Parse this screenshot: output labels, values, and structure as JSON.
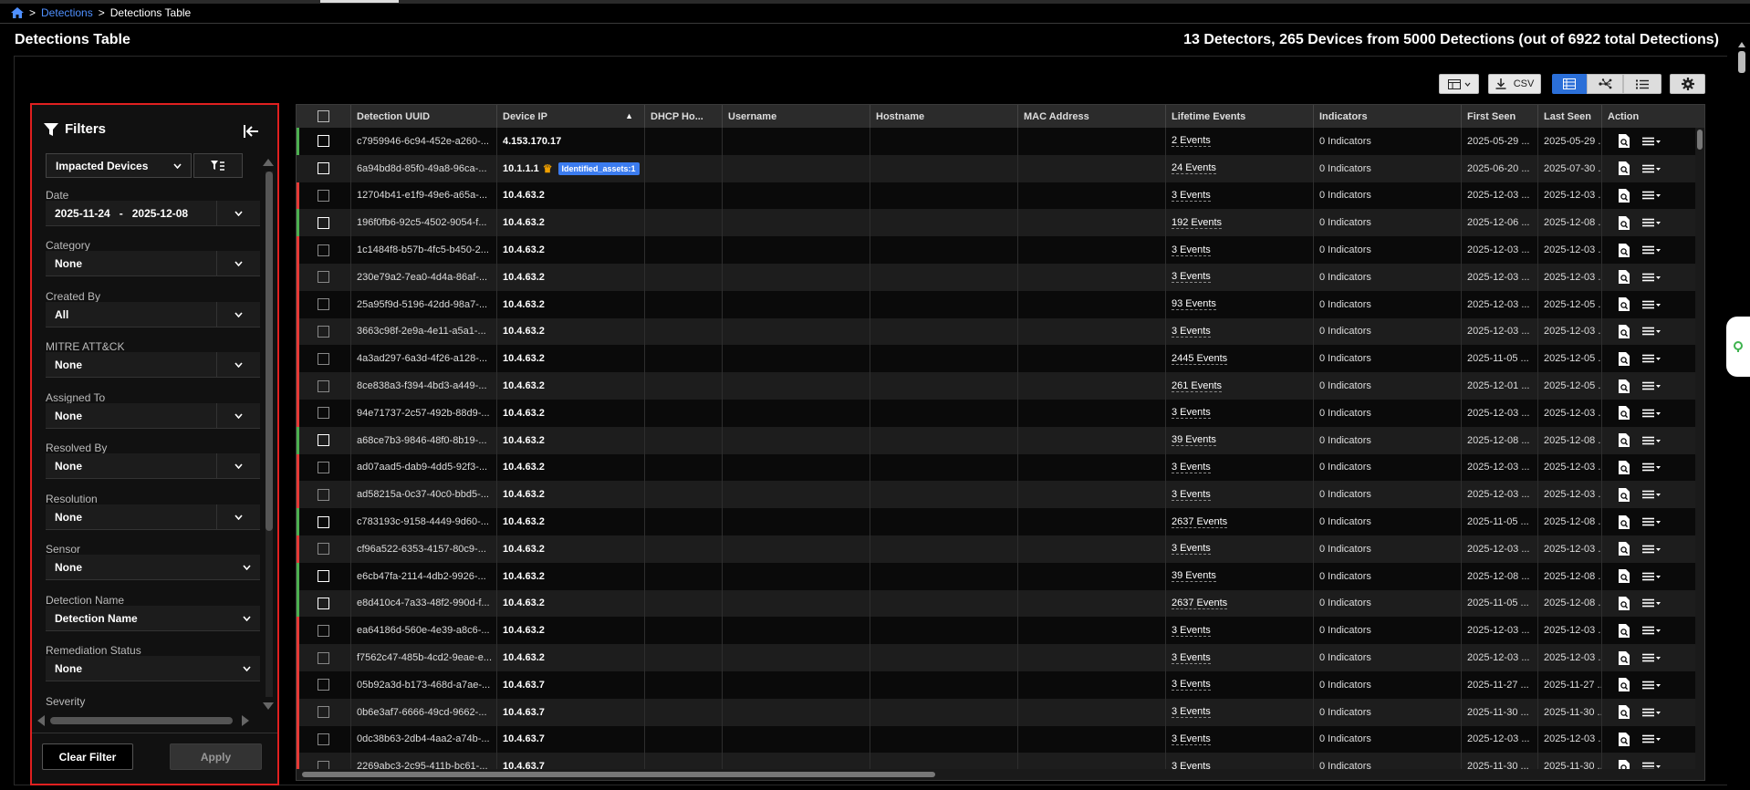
{
  "breadcrumb": {
    "root": "Detections",
    "sep": ">",
    "current": "Detections Table"
  },
  "header": {
    "title": "Detections Table",
    "summary": "13 Detectors, 265 Devices from 5000 Detections (out of 6922 total Detections)"
  },
  "toolbar": {
    "csv_label": "CSV"
  },
  "filters": {
    "title": "Filters",
    "view_select": "Impacted Devices",
    "fields": [
      {
        "label": "Date",
        "value": "2025-11-24   -   2025-12-08"
      },
      {
        "label": "Category",
        "value": "None"
      },
      {
        "label": "Created By",
        "value": "All"
      },
      {
        "label": "MITRE ATT&CK",
        "value": "None"
      },
      {
        "label": "Assigned To",
        "value": "None"
      },
      {
        "label": "Resolved By",
        "value": "None"
      },
      {
        "label": "Resolution",
        "value": "None"
      },
      {
        "label": "Sensor",
        "value": "None"
      },
      {
        "label": "Detection Name",
        "value": "Detection Name"
      },
      {
        "label": "Remediation Status",
        "value": "None"
      },
      {
        "label": "Severity",
        "value": ""
      }
    ],
    "clear_label": "Clear Filter",
    "apply_label": "Apply"
  },
  "table": {
    "columns": [
      "Detection UUID",
      "Device IP",
      "DHCP Ho...",
      "Username",
      "Hostname",
      "MAC Address",
      "Lifetime Events",
      "Indicators",
      "First Seen",
      "Last Seen",
      "Action"
    ],
    "sort_indicator": "▲",
    "tag_text": "Identified_assets:1",
    "crown_glyph": "♛",
    "rows": [
      {
        "uuid": "c7959946-6c94-452e-a260-...",
        "ip": "4.153.170.17",
        "events": "2 Events",
        "indicators": "0 Indicators",
        "first": "2025-05-29 ...",
        "last": "2025-05-29 ...",
        "flag": "#4caf50"
      },
      {
        "uuid": "6a94bd8d-85f0-49a8-96ca-...",
        "ip": "10.1.1.1",
        "crown": true,
        "tag": true,
        "events": "24 Events",
        "indicators": "0 Indicators",
        "first": "2025-06-20 ...",
        "last": "2025-07-30 ...",
        "flag": ""
      },
      {
        "uuid": "12704b41-e1f9-49e6-a65a-...",
        "ip": "10.4.63.2",
        "events": "3 Events",
        "indicators": "0 Indicators",
        "first": "2025-12-03 ...",
        "last": "2025-12-03 ...",
        "flag": "#e53935"
      },
      {
        "uuid": "196f0fb6-92c5-4502-9054-f...",
        "ip": "10.4.63.2",
        "events": "192 Events",
        "indicators": "0 Indicators",
        "first": "2025-12-06 ...",
        "last": "2025-12-08 ...",
        "flag": "#4caf50"
      },
      {
        "uuid": "1c1484f8-b57b-4fc5-b450-2...",
        "ip": "10.4.63.2",
        "events": "3 Events",
        "indicators": "0 Indicators",
        "first": "2025-12-03 ...",
        "last": "2025-12-03 ...",
        "flag": "#e53935"
      },
      {
        "uuid": "230e79a2-7ea0-4d4a-86af-...",
        "ip": "10.4.63.2",
        "events": "3 Events",
        "indicators": "0 Indicators",
        "first": "2025-12-03 ...",
        "last": "2025-12-03 ...",
        "flag": "#e53935"
      },
      {
        "uuid": "25a95f9d-5196-42dd-98a7-...",
        "ip": "10.4.63.2",
        "events": "93 Events",
        "indicators": "0 Indicators",
        "first": "2025-12-03 ...",
        "last": "2025-12-05 ...",
        "flag": "#e53935"
      },
      {
        "uuid": "3663c98f-2e9a-4e11-a5a1-...",
        "ip": "10.4.63.2",
        "events": "3 Events",
        "indicators": "0 Indicators",
        "first": "2025-12-03 ...",
        "last": "2025-12-03 ...",
        "flag": "#e53935"
      },
      {
        "uuid": "4a3ad297-6a3d-4f26-a128-...",
        "ip": "10.4.63.2",
        "events": "2445 Events",
        "indicators": "0 Indicators",
        "first": "2025-11-05 ...",
        "last": "2025-12-05 ...",
        "flag": "#e53935"
      },
      {
        "uuid": "8ce838a3-f394-4bd3-a449-...",
        "ip": "10.4.63.2",
        "events": "261 Events",
        "indicators": "0 Indicators",
        "first": "2025-12-01 ...",
        "last": "2025-12-05 ...",
        "flag": "#e53935"
      },
      {
        "uuid": "94e71737-2c57-492b-88d9-...",
        "ip": "10.4.63.2",
        "events": "3 Events",
        "indicators": "0 Indicators",
        "first": "2025-12-03 ...",
        "last": "2025-12-03 ...",
        "flag": "#e53935"
      },
      {
        "uuid": "a68ce7b3-9846-48f0-8b19-...",
        "ip": "10.4.63.2",
        "events": "39 Events",
        "indicators": "0 Indicators",
        "first": "2025-12-08 ...",
        "last": "2025-12-08 ...",
        "flag": "#4caf50"
      },
      {
        "uuid": "ad07aad5-dab9-4dd5-92f3-...",
        "ip": "10.4.63.2",
        "events": "3 Events",
        "indicators": "0 Indicators",
        "first": "2025-12-03 ...",
        "last": "2025-12-03 ...",
        "flag": "#e53935"
      },
      {
        "uuid": "ad58215a-0c37-40c0-bbd5-...",
        "ip": "10.4.63.2",
        "events": "3 Events",
        "indicators": "0 Indicators",
        "first": "2025-12-03 ...",
        "last": "2025-12-03 ...",
        "flag": "#e53935"
      },
      {
        "uuid": "c783193c-9158-4449-9d60-...",
        "ip": "10.4.63.2",
        "events": "2637 Events",
        "indicators": "0 Indicators",
        "first": "2025-11-05 ...",
        "last": "2025-12-08 ...",
        "flag": "#4caf50"
      },
      {
        "uuid": "cf96a522-6353-4157-80c9-...",
        "ip": "10.4.63.2",
        "events": "3 Events",
        "indicators": "0 Indicators",
        "first": "2025-12-03 ...",
        "last": "2025-12-03 ...",
        "flag": "#e53935"
      },
      {
        "uuid": "e6cb47fa-2114-4db2-9926-...",
        "ip": "10.4.63.2",
        "events": "39 Events",
        "indicators": "0 Indicators",
        "first": "2025-12-08 ...",
        "last": "2025-12-08 ...",
        "flag": "#4caf50"
      },
      {
        "uuid": "e8d410c4-7a33-48f2-990d-f...",
        "ip": "10.4.63.2",
        "events": "2637 Events",
        "indicators": "0 Indicators",
        "first": "2025-11-05 ...",
        "last": "2025-12-08 ...",
        "flag": "#4caf50"
      },
      {
        "uuid": "ea64186d-560e-4e39-a8c6-...",
        "ip": "10.4.63.2",
        "events": "3 Events",
        "indicators": "0 Indicators",
        "first": "2025-12-03 ...",
        "last": "2025-12-03 ...",
        "flag": "#e53935"
      },
      {
        "uuid": "f7562c47-485b-4cd2-9eae-e...",
        "ip": "10.4.63.2",
        "events": "3 Events",
        "indicators": "0 Indicators",
        "first": "2025-12-03 ...",
        "last": "2025-12-03 ...",
        "flag": "#e53935"
      },
      {
        "uuid": "05b92a3d-b173-468d-a7ae-...",
        "ip": "10.4.63.7",
        "events": "3 Events",
        "indicators": "0 Indicators",
        "first": "2025-11-27 ...",
        "last": "2025-11-27 ...",
        "flag": "#e53935"
      },
      {
        "uuid": "0b6e3af7-6666-49cd-9662-...",
        "ip": "10.4.63.7",
        "events": "3 Events",
        "indicators": "0 Indicators",
        "first": "2025-11-30 ...",
        "last": "2025-11-30 ...",
        "flag": "#e53935"
      },
      {
        "uuid": "0dc38b63-2db4-4aa2-a74b-...",
        "ip": "10.4.63.7",
        "events": "3 Events",
        "indicators": "0 Indicators",
        "first": "2025-12-03 ...",
        "last": "2025-12-03 ...",
        "flag": "#e53935"
      },
      {
        "uuid": "2269abc3-2c95-411b-bc61-...",
        "ip": "10.4.63.7",
        "events": "3 Events",
        "indicators": "0 Indicators",
        "first": "2025-11-30 ...",
        "last": "2025-11-30 ...",
        "flag": "#e53935"
      }
    ]
  }
}
